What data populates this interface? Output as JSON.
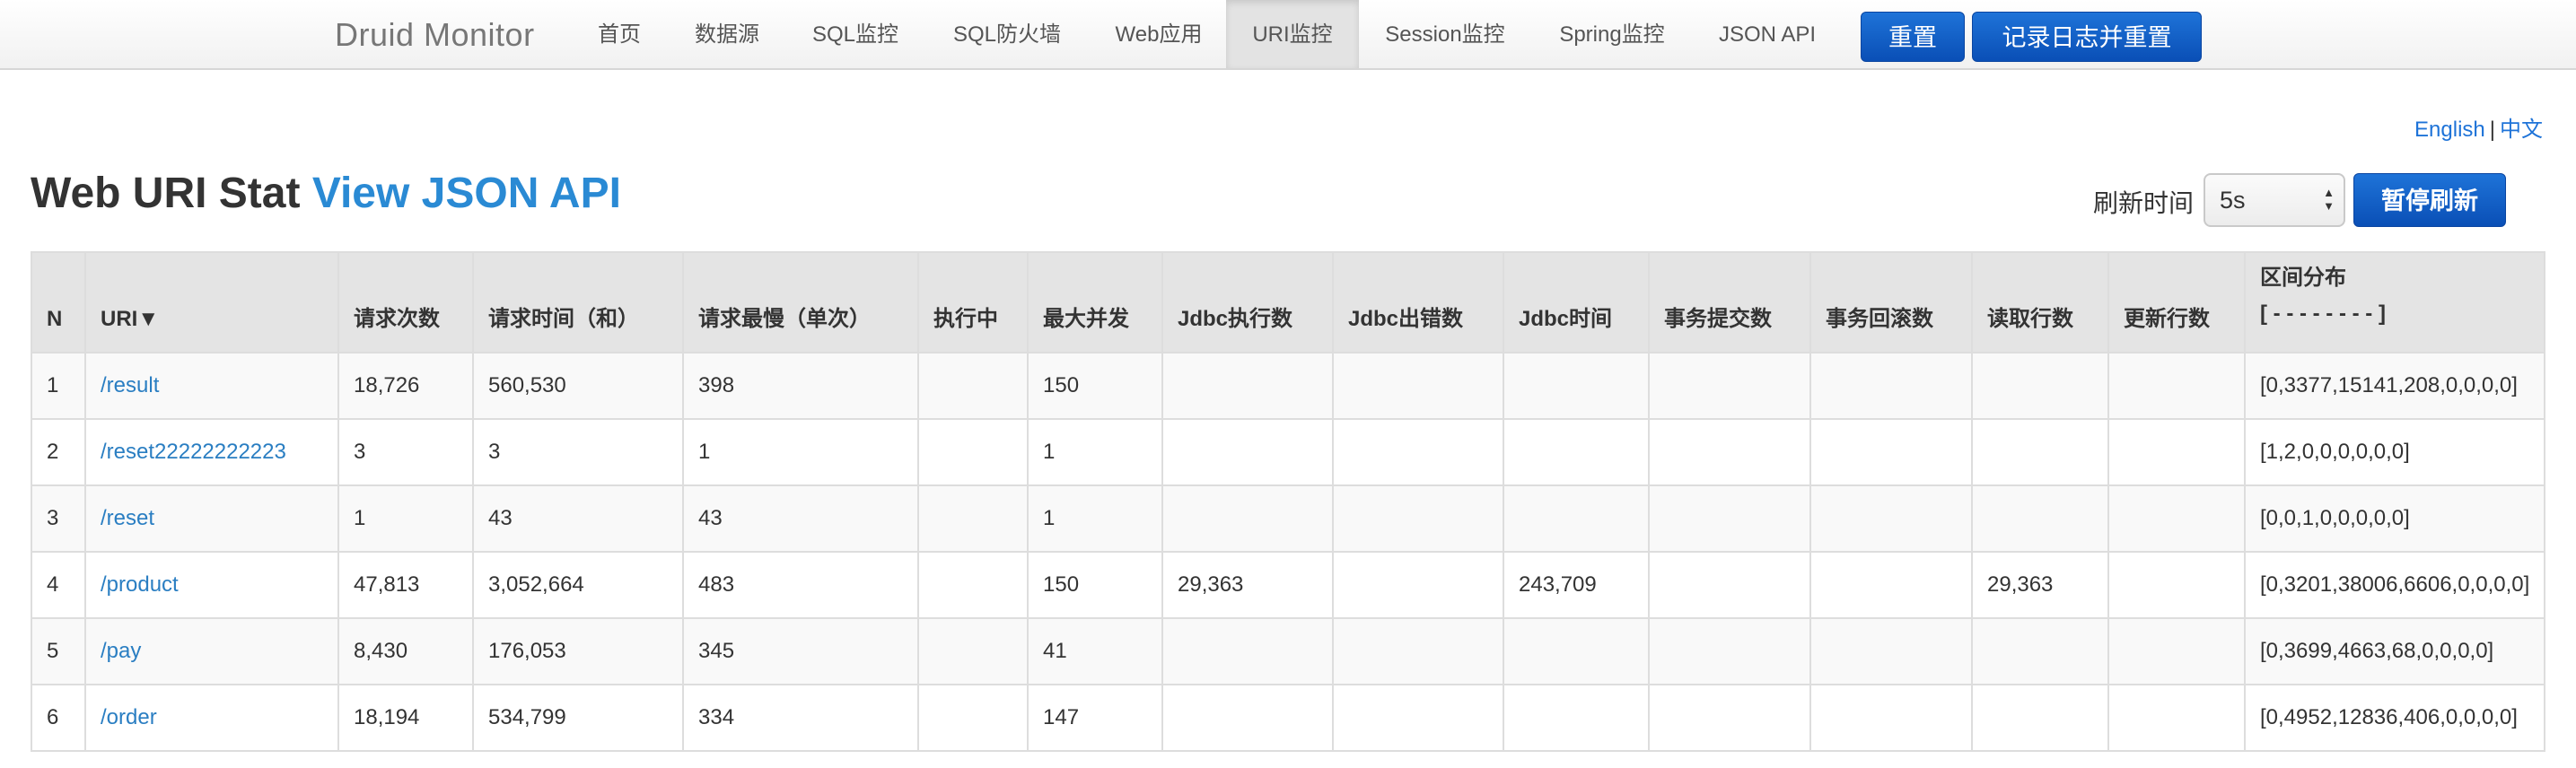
{
  "navbar": {
    "brand": "Druid Monitor",
    "items": [
      {
        "label": "首页",
        "active": false
      },
      {
        "label": "数据源",
        "active": false
      },
      {
        "label": "SQL监控",
        "active": false
      },
      {
        "label": "SQL防火墙",
        "active": false
      },
      {
        "label": "Web应用",
        "active": false
      },
      {
        "label": "URI监控",
        "active": true
      },
      {
        "label": "Session监控",
        "active": false
      },
      {
        "label": "Spring监控",
        "active": false
      },
      {
        "label": "JSON API",
        "active": false
      }
    ],
    "reset_label": "重置",
    "log_reset_label": "记录日志并重置"
  },
  "lang": {
    "english": "English",
    "separator": "|",
    "chinese": "中文"
  },
  "page": {
    "title": "Web URI Stat",
    "json_api_link": "View JSON API",
    "refresh_label": "刷新时间",
    "refresh_value": "5s",
    "pause_label": "暂停刷新"
  },
  "table": {
    "headers": {
      "n": "N",
      "uri": "URI▼",
      "req_count": "请求次数",
      "req_time_sum": "请求时间（和）",
      "req_slowest": "请求最慢（单次）",
      "running": "执行中",
      "max_concurrent": "最大并发",
      "jdbc_exec": "Jdbc执行数",
      "jdbc_error": "Jdbc出错数",
      "jdbc_time": "Jdbc时间",
      "tx_commit": "事务提交数",
      "tx_rollback": "事务回滚数",
      "read_rows": "读取行数",
      "update_rows": "更新行数",
      "dist_title": "区间分布",
      "dist_sub": "[ - - - - - - - - ]"
    },
    "rows": [
      {
        "n": "1",
        "uri": "/result",
        "req_count": "18,726",
        "req_time_sum": "560,530",
        "req_slowest": "398",
        "running": "",
        "max_concurrent": "150",
        "jdbc_exec": "",
        "jdbc_error": "",
        "jdbc_time": "",
        "tx_commit": "",
        "tx_rollback": "",
        "read_rows": "",
        "update_rows": "",
        "dist": "[0,3377,15141,208,0,0,0,0]"
      },
      {
        "n": "2",
        "uri": "/reset22222222223",
        "req_count": "3",
        "req_time_sum": "3",
        "req_slowest": "1",
        "running": "",
        "max_concurrent": "1",
        "jdbc_exec": "",
        "jdbc_error": "",
        "jdbc_time": "",
        "tx_commit": "",
        "tx_rollback": "",
        "read_rows": "",
        "update_rows": "",
        "dist": "[1,2,0,0,0,0,0,0]"
      },
      {
        "n": "3",
        "uri": "/reset",
        "req_count": "1",
        "req_time_sum": "43",
        "req_slowest": "43",
        "running": "",
        "max_concurrent": "1",
        "jdbc_exec": "",
        "jdbc_error": "",
        "jdbc_time": "",
        "tx_commit": "",
        "tx_rollback": "",
        "read_rows": "",
        "update_rows": "",
        "dist": "[0,0,1,0,0,0,0,0]"
      },
      {
        "n": "4",
        "uri": "/product",
        "req_count": "47,813",
        "req_time_sum": "3,052,664",
        "req_slowest": "483",
        "running": "",
        "max_concurrent": "150",
        "jdbc_exec": "29,363",
        "jdbc_error": "",
        "jdbc_time": "243,709",
        "tx_commit": "",
        "tx_rollback": "",
        "read_rows": "29,363",
        "update_rows": "",
        "dist": "[0,3201,38006,6606,0,0,0,0]"
      },
      {
        "n": "5",
        "uri": "/pay",
        "req_count": "8,430",
        "req_time_sum": "176,053",
        "req_slowest": "345",
        "running": "",
        "max_concurrent": "41",
        "jdbc_exec": "",
        "jdbc_error": "",
        "jdbc_time": "",
        "tx_commit": "",
        "tx_rollback": "",
        "read_rows": "",
        "update_rows": "",
        "dist": "[0,3699,4663,68,0,0,0,0]"
      },
      {
        "n": "6",
        "uri": "/order",
        "req_count": "18,194",
        "req_time_sum": "534,799",
        "req_slowest": "334",
        "running": "",
        "max_concurrent": "147",
        "jdbc_exec": "",
        "jdbc_error": "",
        "jdbc_time": "",
        "tx_commit": "",
        "tx_rollback": "",
        "read_rows": "",
        "update_rows": "",
        "dist": "[0,4952,12836,406,0,0,0,0]"
      }
    ]
  },
  "colors": {
    "accent": "#1e73d8",
    "link": "#2a7ec2",
    "header_bg": "#e4e4e4"
  }
}
